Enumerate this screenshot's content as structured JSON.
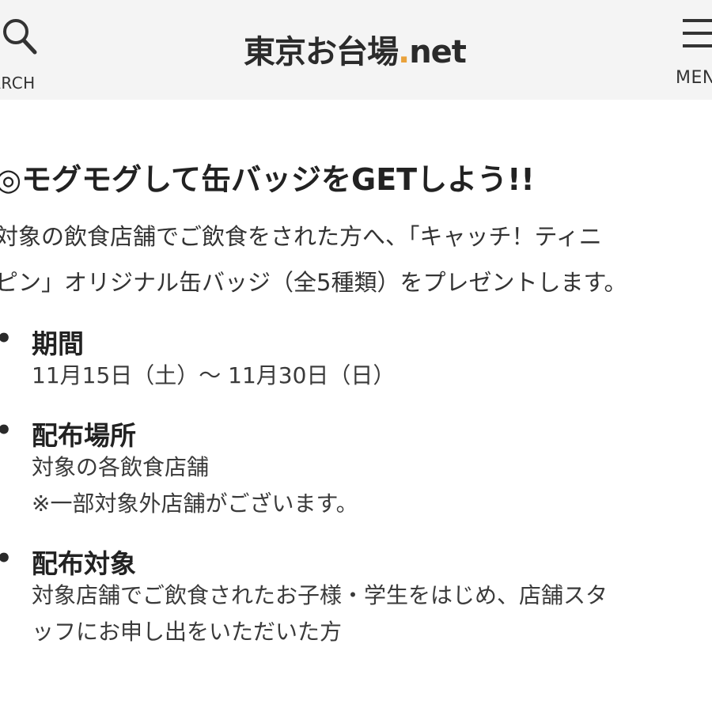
{
  "header": {
    "search_label": "EARCH",
    "logo_text": "東京お台場",
    "logo_dot": ".",
    "logo_suffix": "net",
    "menu_label": "MEN"
  },
  "article": {
    "headline": "◎モグモグして缶バッジをGETしよう!!",
    "intro_lines": [
      "対象の飲食店舗でご飲食をされた方へ、「キャッチ！ティニ",
      "ピン」オリジナル缶バッジ（全5種類）をプレゼントします。"
    ],
    "sections": [
      {
        "bullet": "•",
        "title": "期間",
        "lines": [
          "11月15日（土）～ 11月30日（日）"
        ]
      },
      {
        "bullet": "•",
        "title": "配布場所",
        "lines": [
          "対象の各飲食店舗",
          "※一部対象外店舗がございます。"
        ]
      },
      {
        "bullet": "•",
        "title": "配布対象",
        "lines": [
          "対象店舗でご飲食されたお子様・学生をはじめ、店舗スタ",
          "ッフにお申し出をいただいた方"
        ]
      }
    ]
  },
  "colors": {
    "header_bg": "#f4f4f4",
    "logo_accent": "#e9a23b",
    "text": "#2a2a2a"
  },
  "icons": {
    "search": "search-icon",
    "menu": "hamburger-menu-icon"
  }
}
